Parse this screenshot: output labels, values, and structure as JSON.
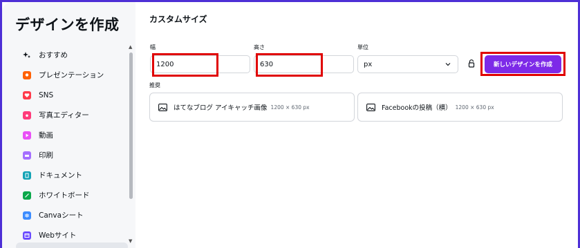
{
  "sidebar": {
    "title": "デザインを作成",
    "items": [
      {
        "label": "おすすめ",
        "icon": "sparkle-icon",
        "color": "#0e1318"
      },
      {
        "label": "プレゼンテーション",
        "icon": "presentation-icon",
        "color": "#ff6105"
      },
      {
        "label": "SNS",
        "icon": "heart-icon",
        "color": "#ff3b4b"
      },
      {
        "label": "写真エディター",
        "icon": "camera-icon",
        "color": "#ff3b7a"
      },
      {
        "label": "動画",
        "icon": "video-icon",
        "color": "#e950f7"
      },
      {
        "label": "印刷",
        "icon": "printer-icon",
        "color": "#a570ff"
      },
      {
        "label": "ドキュメント",
        "icon": "document-icon",
        "color": "#13a3b5"
      },
      {
        "label": "ホワイトボード",
        "icon": "whiteboard-icon",
        "color": "#0ba84a"
      },
      {
        "label": "Canvaシート",
        "icon": "sheet-icon",
        "color": "#3c8cff"
      },
      {
        "label": "Webサイト",
        "icon": "website-icon",
        "color": "#6b4cff"
      }
    ]
  },
  "main": {
    "title": "カスタムサイズ",
    "width": {
      "label": "幅",
      "value": "1200"
    },
    "height": {
      "label": "高さ",
      "value": "630"
    },
    "unit": {
      "label": "単位",
      "value": "px"
    },
    "create_button": "新しいデザインを作成",
    "recommended_label": "推奨",
    "recommended": [
      {
        "name": "はてなブログ アイキャッチ画像",
        "dims": "1200 × 630 px"
      },
      {
        "name": "Facebookの投稿（横）",
        "dims": "1200 × 630 px"
      }
    ]
  },
  "colors": {
    "accent": "#7d2ae8",
    "highlight": "#e00000",
    "frame": "#4d2fd6"
  }
}
